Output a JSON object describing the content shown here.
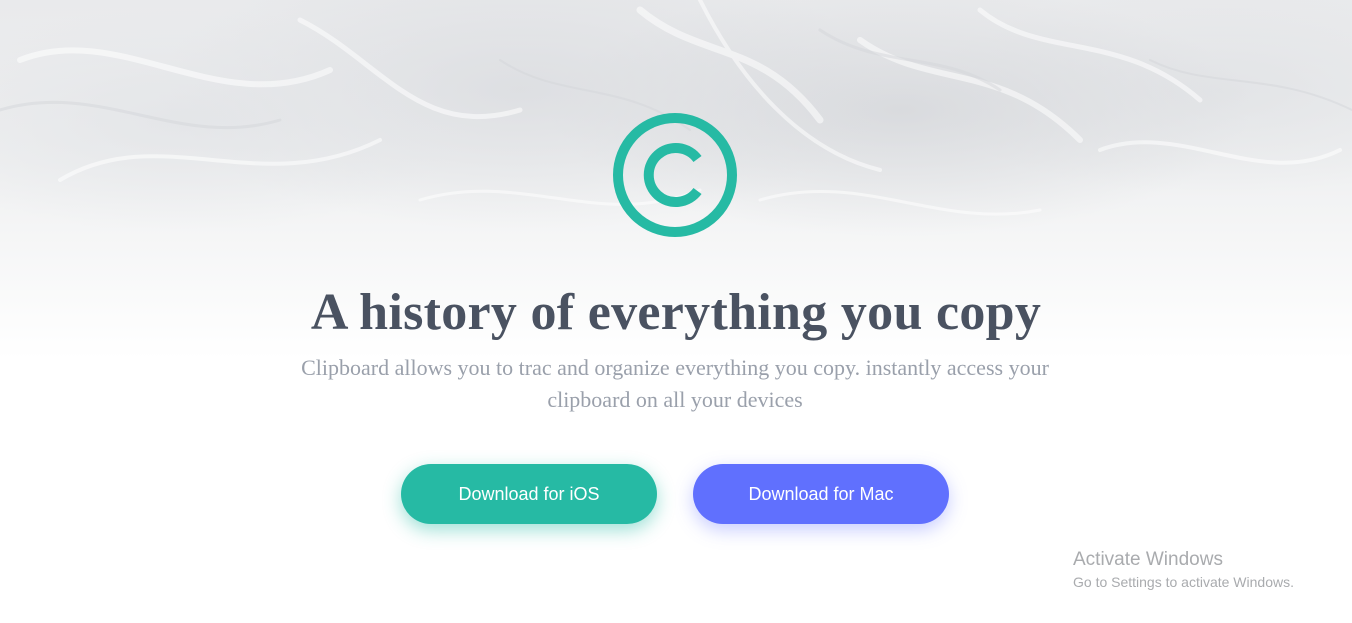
{
  "hero": {
    "logo_icon": "copyright-c-icon",
    "accent_color": "#26baa4",
    "headline": "A history of everything you copy",
    "subtitle": "Clipboard allows you to trac and organize everything you copy. instantly access your clipboard on all your devices"
  },
  "actions": {
    "ios_label": "Download for iOS",
    "ios_color": "#26baa4",
    "mac_label": "Download for Mac",
    "mac_color": "#6070fe"
  },
  "watermark": {
    "title": "Activate Windows",
    "subtitle": "Go to Settings to activate Windows."
  }
}
